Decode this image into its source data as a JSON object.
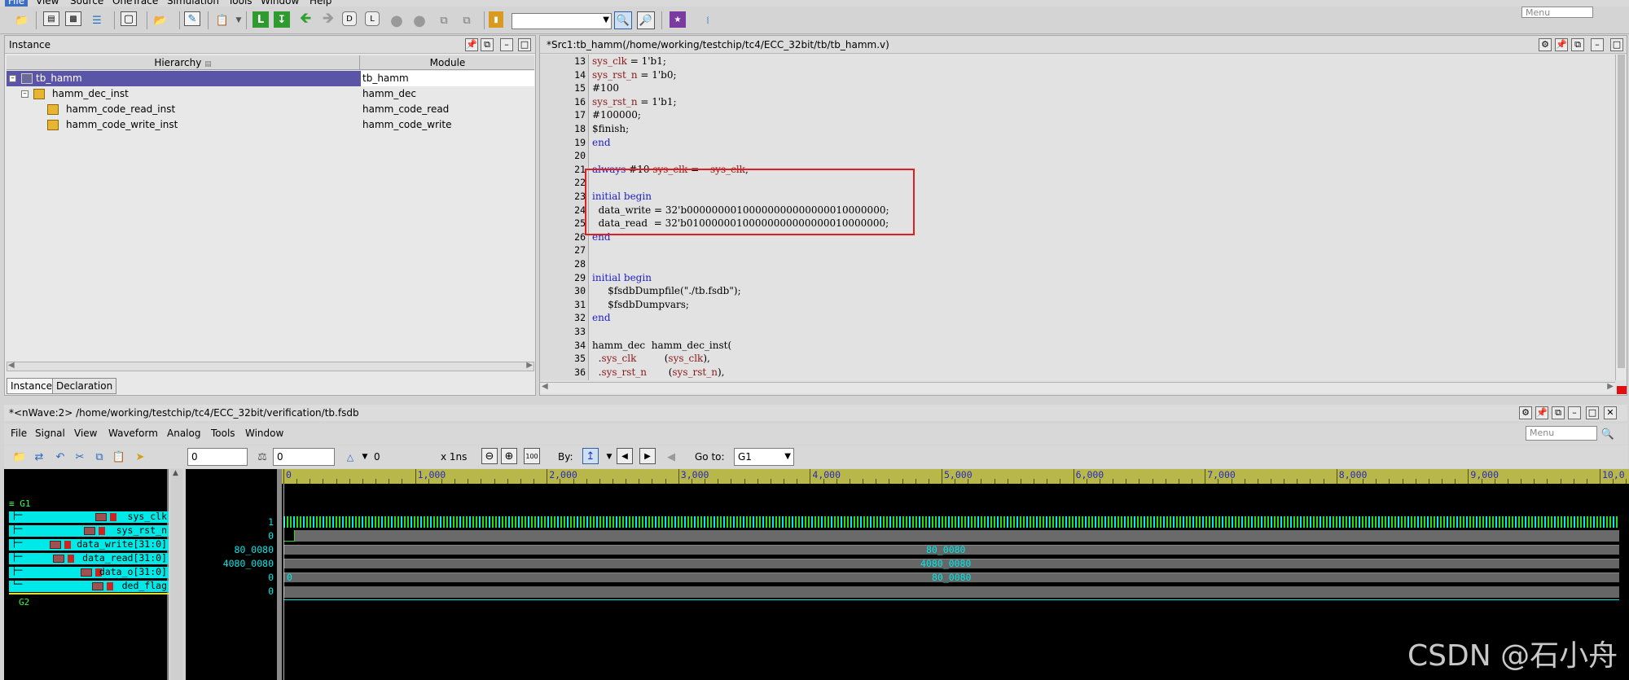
{
  "top_menu": [
    "File",
    "View",
    "Source",
    "OneTrace",
    "Simulation",
    "Tools",
    "Window",
    "Help"
  ],
  "top_search_placeholder": "Menu",
  "instance_panel": {
    "title": "Instance",
    "col_hierarchy": "Hierarchy",
    "col_module": "Module",
    "rows": [
      {
        "name": "tb_hamm",
        "module": "tb_hamm"
      },
      {
        "name": "hamm_dec_inst",
        "module": "hamm_dec"
      },
      {
        "name": "hamm_code_read_inst",
        "module": "hamm_code_read"
      },
      {
        "name": "hamm_code_write_inst",
        "module": "hamm_code_write"
      }
    ],
    "tabs": [
      "Instance",
      "Declaration"
    ]
  },
  "source_panel": {
    "title": "*Src1:tb_hamm(/home/working/testchip/tc4/ECC_32bit/tb/tb_hamm.v)",
    "line_numbers": [
      "13",
      "14",
      "15",
      "16",
      "17",
      "18",
      "19",
      "20",
      "21",
      "22",
      "23",
      "24",
      "25",
      "26",
      "27",
      "28",
      "29",
      "30",
      "31",
      "32",
      "33",
      "34",
      "35",
      "36"
    ],
    "lines": [
      "sys_clk = 1'b1;",
      "sys_rst_n = 1'b0;",
      "#100",
      "sys_rst_n = 1'b1;",
      "#100000;",
      "$finish;",
      "end",
      "",
      "always #10 sys_clk = ~sys_clk;",
      "",
      "initial begin",
      "  data_write = 32'b00000000100000000000000010000000;",
      "  data_read  = 32'b01000000100000000000000010000000;",
      "end",
      "",
      "",
      "initial begin",
      "     $fsdbDumpfile(\"./tb.fsdb\");",
      "     $fsdbDumpvars;",
      "end",
      "",
      "hamm_dec  hamm_dec_inst(",
      "  .sys_clk         (sys_clk),",
      "  .sys_rst_n       (sys_rst_n),"
    ]
  },
  "nwave": {
    "title": "*<nWave:2> /home/working/testchip/tc4/ECC_32bit/verification/tb.fsdb",
    "menu": [
      "File",
      "Signal",
      "View",
      "Waveform",
      "Analog",
      "Tools",
      "Window"
    ],
    "search_placeholder": "Menu",
    "cursor_time": "0",
    "marker_time": "0",
    "delta": "0",
    "scale": "x 1ns",
    "by_label": "By:",
    "goto_label": "Go to:",
    "goto_value": "G1",
    "groups": [
      "G1",
      "G2"
    ],
    "signals": [
      {
        "name": "sys_clk",
        "value": "1"
      },
      {
        "name": "sys_rst_n",
        "value": "0"
      },
      {
        "name": "data_write[31:0]",
        "value": "80_0080"
      },
      {
        "name": "data_read[31:0]",
        "value": "4080_0080"
      },
      {
        "name": "data_o[31:0]",
        "value": "0"
      },
      {
        "name": "ded_flag",
        "value": "0"
      }
    ],
    "ruler_ticks": [
      "0",
      "1,000",
      "2,000",
      "3,000",
      "4,000",
      "5,000",
      "6,000",
      "7,000",
      "8,000",
      "9,000",
      "10,0"
    ],
    "bus_values": {
      "data_write": "80_0080",
      "data_read": "4080_0080",
      "data_o_start": "0",
      "data_o": "80_0080"
    }
  },
  "watermark": "CSDN @石小舟",
  "colors": {
    "selection": "#5b55a8",
    "signal_bar": "#00e9e9",
    "clock_wave": "#20e020",
    "highlight": "#e02020"
  }
}
